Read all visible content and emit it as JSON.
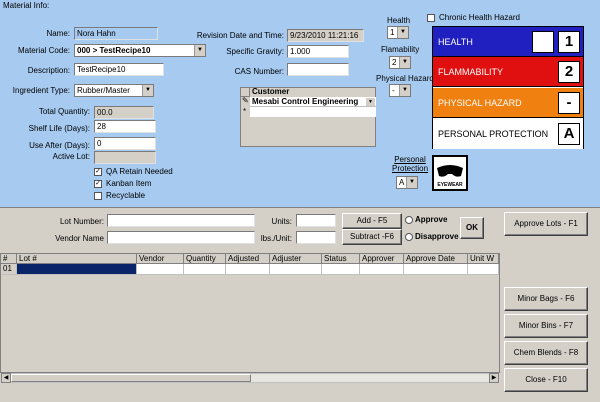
{
  "section_title": "Material Info:",
  "name": {
    "label": "Name:",
    "value": "Nora Hahn"
  },
  "material_code": {
    "label": "Material Code:",
    "value": "000   > TestRecipe10"
  },
  "description": {
    "label": "Description:",
    "value": "TestRecipe10"
  },
  "ingredient_type": {
    "label": "Ingredient Type:",
    "value": "Rubber/Master"
  },
  "total_quantity": {
    "label": "Total Quantity:",
    "value": "00.0"
  },
  "shelf_life": {
    "label": "Shelf Life (Days):",
    "value": "28"
  },
  "use_after": {
    "label": "Use After (Days):",
    "value": "0"
  },
  "active_lot": {
    "label": "Active Lot:",
    "value": ""
  },
  "checks": {
    "qa": "QA Retain Needed",
    "kanban": "Kanban Item",
    "recyclable": "Recyclable"
  },
  "revision": {
    "label": "Revision Date and Time:",
    "value": "9/23/2010 11:21:16"
  },
  "specific_gravity": {
    "label": "Specific Gravity:",
    "value": "1.000"
  },
  "cas_number": {
    "label": "CAS Number:",
    "value": ""
  },
  "customer": {
    "header": "Customer",
    "row1": "Mesabi Control Engineering",
    "edit_mark": "✎",
    "new_mark": "*"
  },
  "health": {
    "label": "Health",
    "value": "1"
  },
  "flammability": {
    "label": "Flamability",
    "value": "2"
  },
  "physical_hazard": {
    "label": "Physical Hazard",
    "value": "-"
  },
  "personal_protection": {
    "label": "Personal Protection",
    "value": "A"
  },
  "chronic": "Chronic Health Hazard",
  "hazard_panel": {
    "health": {
      "label": "HEALTH",
      "value": "1",
      "color": "#2020c0"
    },
    "flammability": {
      "label": "FLAMMABILITY",
      "value": "2",
      "color": "#e01010"
    },
    "physical": {
      "label": "PHYSICAL HAZARD",
      "value": "-",
      "color": "#f08010"
    },
    "protection": {
      "label": "PERSONAL PROTECTION",
      "value": "A",
      "color": "#ffffff"
    }
  },
  "goggle_text": "EYEWEAR",
  "lot_form": {
    "lot_number": "Lot Number:",
    "vendor_name": "Vendor Name",
    "units": "Units:",
    "lbs_unit": "lbs./Unit:",
    "add": "Add - F5",
    "subtract": "Subtract -F6",
    "approve": "Approve",
    "disapprove": "Disapprove",
    "ok": "OK"
  },
  "grid": {
    "columns": [
      "#",
      "Lot #",
      "Vendor",
      "Quantity",
      "Adjusted",
      "Adjuster",
      "Status",
      "Approver",
      "Approve Date",
      "Unit W"
    ],
    "row1": "01"
  },
  "side_buttons": {
    "approve_lots": "Approve Lots - F1",
    "minor_bags": "Minor Bags - F6",
    "minor_bins": "Minor Bins - F7",
    "chem_blends": "Chem Blends - F8",
    "close": "Close - F10"
  }
}
